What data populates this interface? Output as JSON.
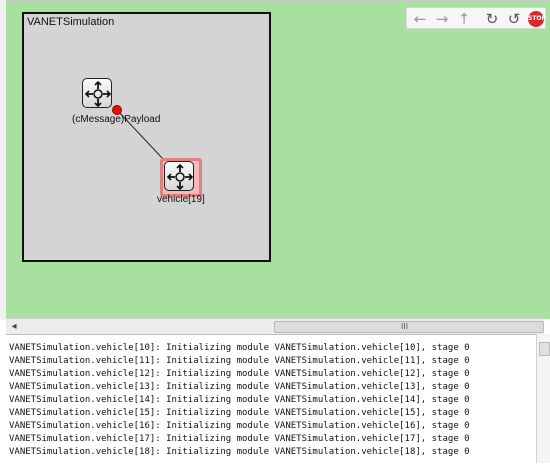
{
  "network": {
    "title": "VANETSimulation"
  },
  "modules": [
    {
      "id": "payload",
      "label": "(cMessage)Payload",
      "selected": false,
      "icon": "node-module-icon"
    },
    {
      "id": "vehicle",
      "label": "vehicle[19]",
      "selected": true,
      "icon": "node-module-icon"
    }
  ],
  "toolbar": {
    "buttons": [
      {
        "name": "back-arrow-icon",
        "glyph": "←"
      },
      {
        "name": "forward-arrow-icon",
        "glyph": "→"
      },
      {
        "name": "up-arrow-icon",
        "glyph": "↑"
      },
      {
        "name": "zoom-in-icon",
        "glyph": "↻"
      },
      {
        "name": "zoom-out-icon",
        "glyph": "↺"
      }
    ],
    "stop_label": "STOP"
  },
  "hscroll": {
    "grip": "III",
    "left_arrow": "◂"
  },
  "log": {
    "lines": [
      "VANETSimulation.vehicle[10]: Initializing module VANETSimulation.vehicle[10], stage 0",
      "VANETSimulation.vehicle[11]: Initializing module VANETSimulation.vehicle[11], stage 0",
      "VANETSimulation.vehicle[12]: Initializing module VANETSimulation.vehicle[12], stage 0",
      "VANETSimulation.vehicle[13]: Initializing module VANETSimulation.vehicle[13], stage 0",
      "VANETSimulation.vehicle[14]: Initializing module VANETSimulation.vehicle[14], stage 0",
      "VANETSimulation.vehicle[15]: Initializing module VANETSimulation.vehicle[15], stage 0",
      "VANETSimulation.vehicle[16]: Initializing module VANETSimulation.vehicle[16], stage 0",
      "VANETSimulation.vehicle[17]: Initializing module VANETSimulation.vehicle[17], stage 0",
      "VANETSimulation.vehicle[18]: Initializing module VANETSimulation.vehicle[18], stage 0"
    ]
  },
  "colors": {
    "canvas_bg": "#a8e0a0",
    "network_bg": "#d4d4d4",
    "selection": "#e08080",
    "stop_button": "#d42a2a",
    "message_dot": "#e01010"
  }
}
